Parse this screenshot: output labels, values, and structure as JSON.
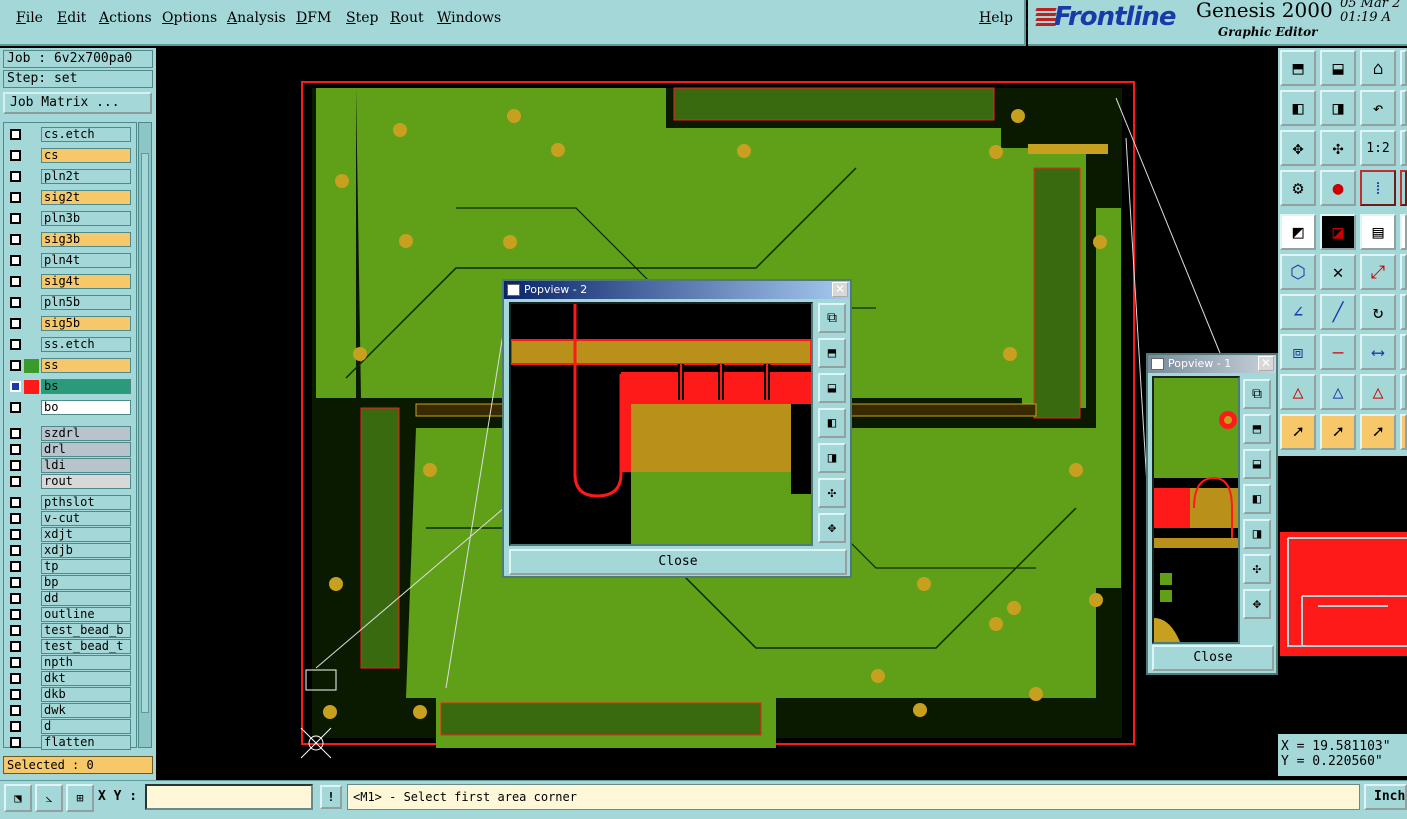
{
  "menubar": {
    "items": [
      "File",
      "Edit",
      "Actions",
      "Options",
      "Analysis",
      "DFM",
      "Step",
      "Rout",
      "Windows"
    ],
    "help": "Help"
  },
  "brand": {
    "logo": "Frontline",
    "product": "Genesis 2000",
    "subtitle": "Graphic Editor",
    "date_line1": "05 Mar 2",
    "date_line2": "01:19 A"
  },
  "job": {
    "job_label": "Job : 6v2x700pa0",
    "step_label": "Step: set",
    "matrix_button": "Job Matrix ..."
  },
  "layers": [
    {
      "name": "cs.etch",
      "color": "#a4d8d8"
    },
    {
      "name": "cs",
      "color": "#f7c86a"
    },
    {
      "name": "pln2t",
      "color": "#a4d8d8"
    },
    {
      "name": "sig2t",
      "color": "#f7c86a"
    },
    {
      "name": "pln3b",
      "color": "#a4d8d8"
    },
    {
      "name": "sig3b",
      "color": "#f7c86a"
    },
    {
      "name": "pln4t",
      "color": "#a4d8d8"
    },
    {
      "name": "sig4t",
      "color": "#f7c86a"
    },
    {
      "name": "pln5b",
      "color": "#a4d8d8"
    },
    {
      "name": "sig5b",
      "color": "#f7c86a"
    },
    {
      "name": "ss.etch",
      "color": "#a4d8d8"
    },
    {
      "name": "ss",
      "color": "#f7c86a"
    },
    {
      "name": "bs",
      "color": "#2a9a7a"
    },
    {
      "name": "bo",
      "color": "#ffffff"
    },
    {
      "name": "szdrl",
      "color": "#b8c4cc"
    },
    {
      "name": "drl",
      "color": "#b8c4cc"
    },
    {
      "name": "ldi",
      "color": "#b8c4cc"
    },
    {
      "name": "rout",
      "color": "#d8d8d8"
    },
    {
      "name": "pthslot",
      "color": "#a4d8d8"
    },
    {
      "name": "v-cut",
      "color": "#a4d8d8"
    },
    {
      "name": "xdjt",
      "color": "#a4d8d8"
    },
    {
      "name": "xdjb",
      "color": "#a4d8d8"
    },
    {
      "name": "tp",
      "color": "#a4d8d8"
    },
    {
      "name": "bp",
      "color": "#a4d8d8"
    },
    {
      "name": "dd",
      "color": "#a4d8d8"
    },
    {
      "name": "outline",
      "color": "#a4d8d8"
    },
    {
      "name": "test_bead_b",
      "color": "#a4d8d8"
    },
    {
      "name": "test_bead_t",
      "color": "#a4d8d8"
    },
    {
      "name": "npth",
      "color": "#a4d8d8"
    },
    {
      "name": "dkt",
      "color": "#a4d8d8"
    },
    {
      "name": "dkb",
      "color": "#a4d8d8"
    },
    {
      "name": "dwk",
      "color": "#a4d8d8"
    },
    {
      "name": "d",
      "color": "#a4d8d8"
    },
    {
      "name": "flatten",
      "color": "#a4d8d8"
    }
  ],
  "selected": "Selected : 0",
  "popview2": {
    "title": "Popview - 2",
    "close_label": "Close"
  },
  "popview1": {
    "title": "Popview - 1",
    "close_label": "Close"
  },
  "coords": {
    "x": "X = 19.581103\"",
    "y": "Y = 0.220560\""
  },
  "statusbar": {
    "xy_label": "X Y :",
    "xy_value": "",
    "message_icon": "!",
    "message": "<M1> - Select first area corner",
    "units": "Inch"
  },
  "colors": {
    "panel": "#a4d8d8",
    "board_fill": "#5fa018",
    "trace": "#0a2a00",
    "pad": "#c8a020",
    "outline_red": "#ff1a1a",
    "selected_bg": "#f7c86a"
  },
  "icons": {
    "left_tools": [
      "zoom-area-icon",
      "measure-icon",
      "grid-icon"
    ],
    "right_tools": [
      "zoom-home-icon",
      "pan-center-icon",
      "zoom-fit-icon",
      "zoom-left-icon",
      "zoom-right-icon",
      "zoom-back-icon",
      "zoom-in-icon",
      "zoom-out-icon",
      "zoom-one-to-one-icon",
      "snap-icon",
      "net-icon",
      "layer-feature-icon",
      "select-icon",
      "draw-icon",
      "ruler-icon"
    ]
  }
}
